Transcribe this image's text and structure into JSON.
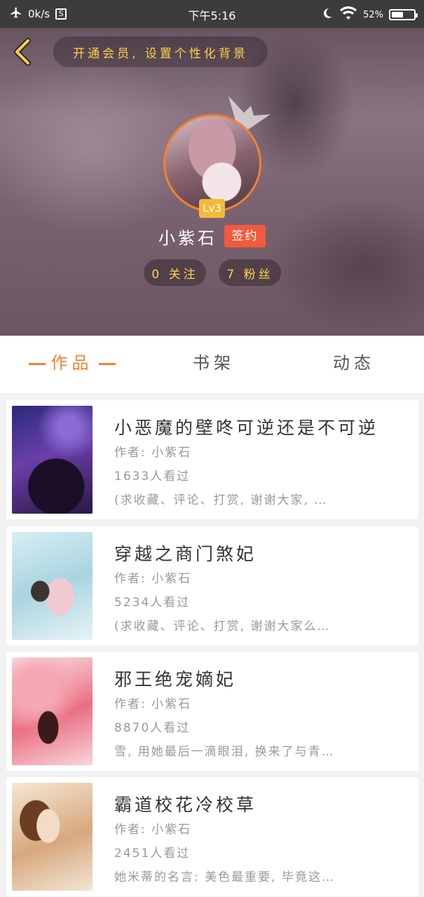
{
  "status_bar": {
    "speed": "0k/s",
    "s_icon": "S",
    "time": "下午5:16",
    "battery": "52%",
    "battery_level": 0.52,
    "icons": [
      "airplane-icon",
      "s-box-icon",
      "moon-icon",
      "wifi-icon",
      "battery-icon"
    ]
  },
  "header": {
    "vip_promo": "开通会员, 设置个性化背景",
    "level": "Lv3",
    "username": "小紫石",
    "sign_badge": "签约",
    "following": "0 关注",
    "fans": "7 粉丝",
    "colors": {
      "accent": "#f4812f",
      "gold": "#ffd24a",
      "sign": "#f25a3c",
      "level": "#f4b93a"
    }
  },
  "tabs": [
    {
      "label": "作品",
      "active": true
    },
    {
      "label": "书架",
      "active": false
    },
    {
      "label": "动态",
      "active": false
    }
  ],
  "books": [
    {
      "title": "小恶魔的壁咚可逆还是不可逆",
      "author": "作者: 小紫石",
      "views": "1633人看过",
      "desc": "(求收藏、评论、打赏, 谢谢大家, …"
    },
    {
      "title": "穿越之商门煞妃",
      "author": "作者: 小紫石",
      "views": "5234人看过",
      "desc": "(求收藏、评论、打赏, 谢谢大家么…"
    },
    {
      "title": "邪王绝宠嫡妃",
      "author": "作者: 小紫石",
      "views": "8870人看过",
      "desc": "雪, 用她最后一滴眼泪, 换来了与青…"
    },
    {
      "title": "霸道校花冷校草",
      "author": "作者: 小紫石",
      "views": "2451人看过",
      "desc": "她米蒂的名言: 美色最重要, 毕竟这…"
    }
  ]
}
